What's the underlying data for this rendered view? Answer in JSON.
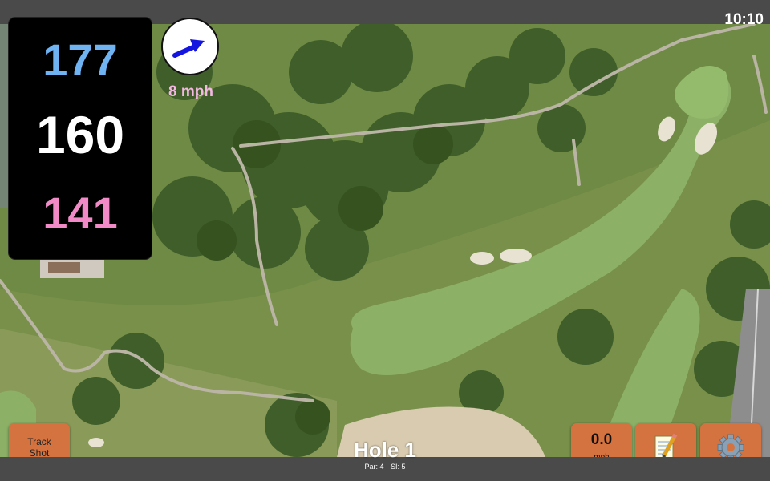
{
  "status_bar": {
    "time": "10:10"
  },
  "yardages": {
    "back": "177",
    "center": "160",
    "front": "141",
    "colors": {
      "back": "#6fb3f2",
      "center": "#ffffff",
      "front": "#f28ac7"
    }
  },
  "wind": {
    "speed": "8 mph",
    "color": "#f5b8e4",
    "arrow_color": "#1515e0",
    "icon": "wind-direction-arrow-icon"
  },
  "buttons": {
    "track_shot": {
      "line1": "Track",
      "line2": "Shot"
    },
    "speed": {
      "value": "0.0",
      "unit": "mph"
    },
    "notes": {
      "icon": "notepad-pencil-icon"
    },
    "settings": {
      "icon": "gear-icon"
    },
    "color": "#d4733f"
  },
  "hole": {
    "title": "Hole 1",
    "par": "Par: 4",
    "stroke_index": "SI: 5"
  }
}
